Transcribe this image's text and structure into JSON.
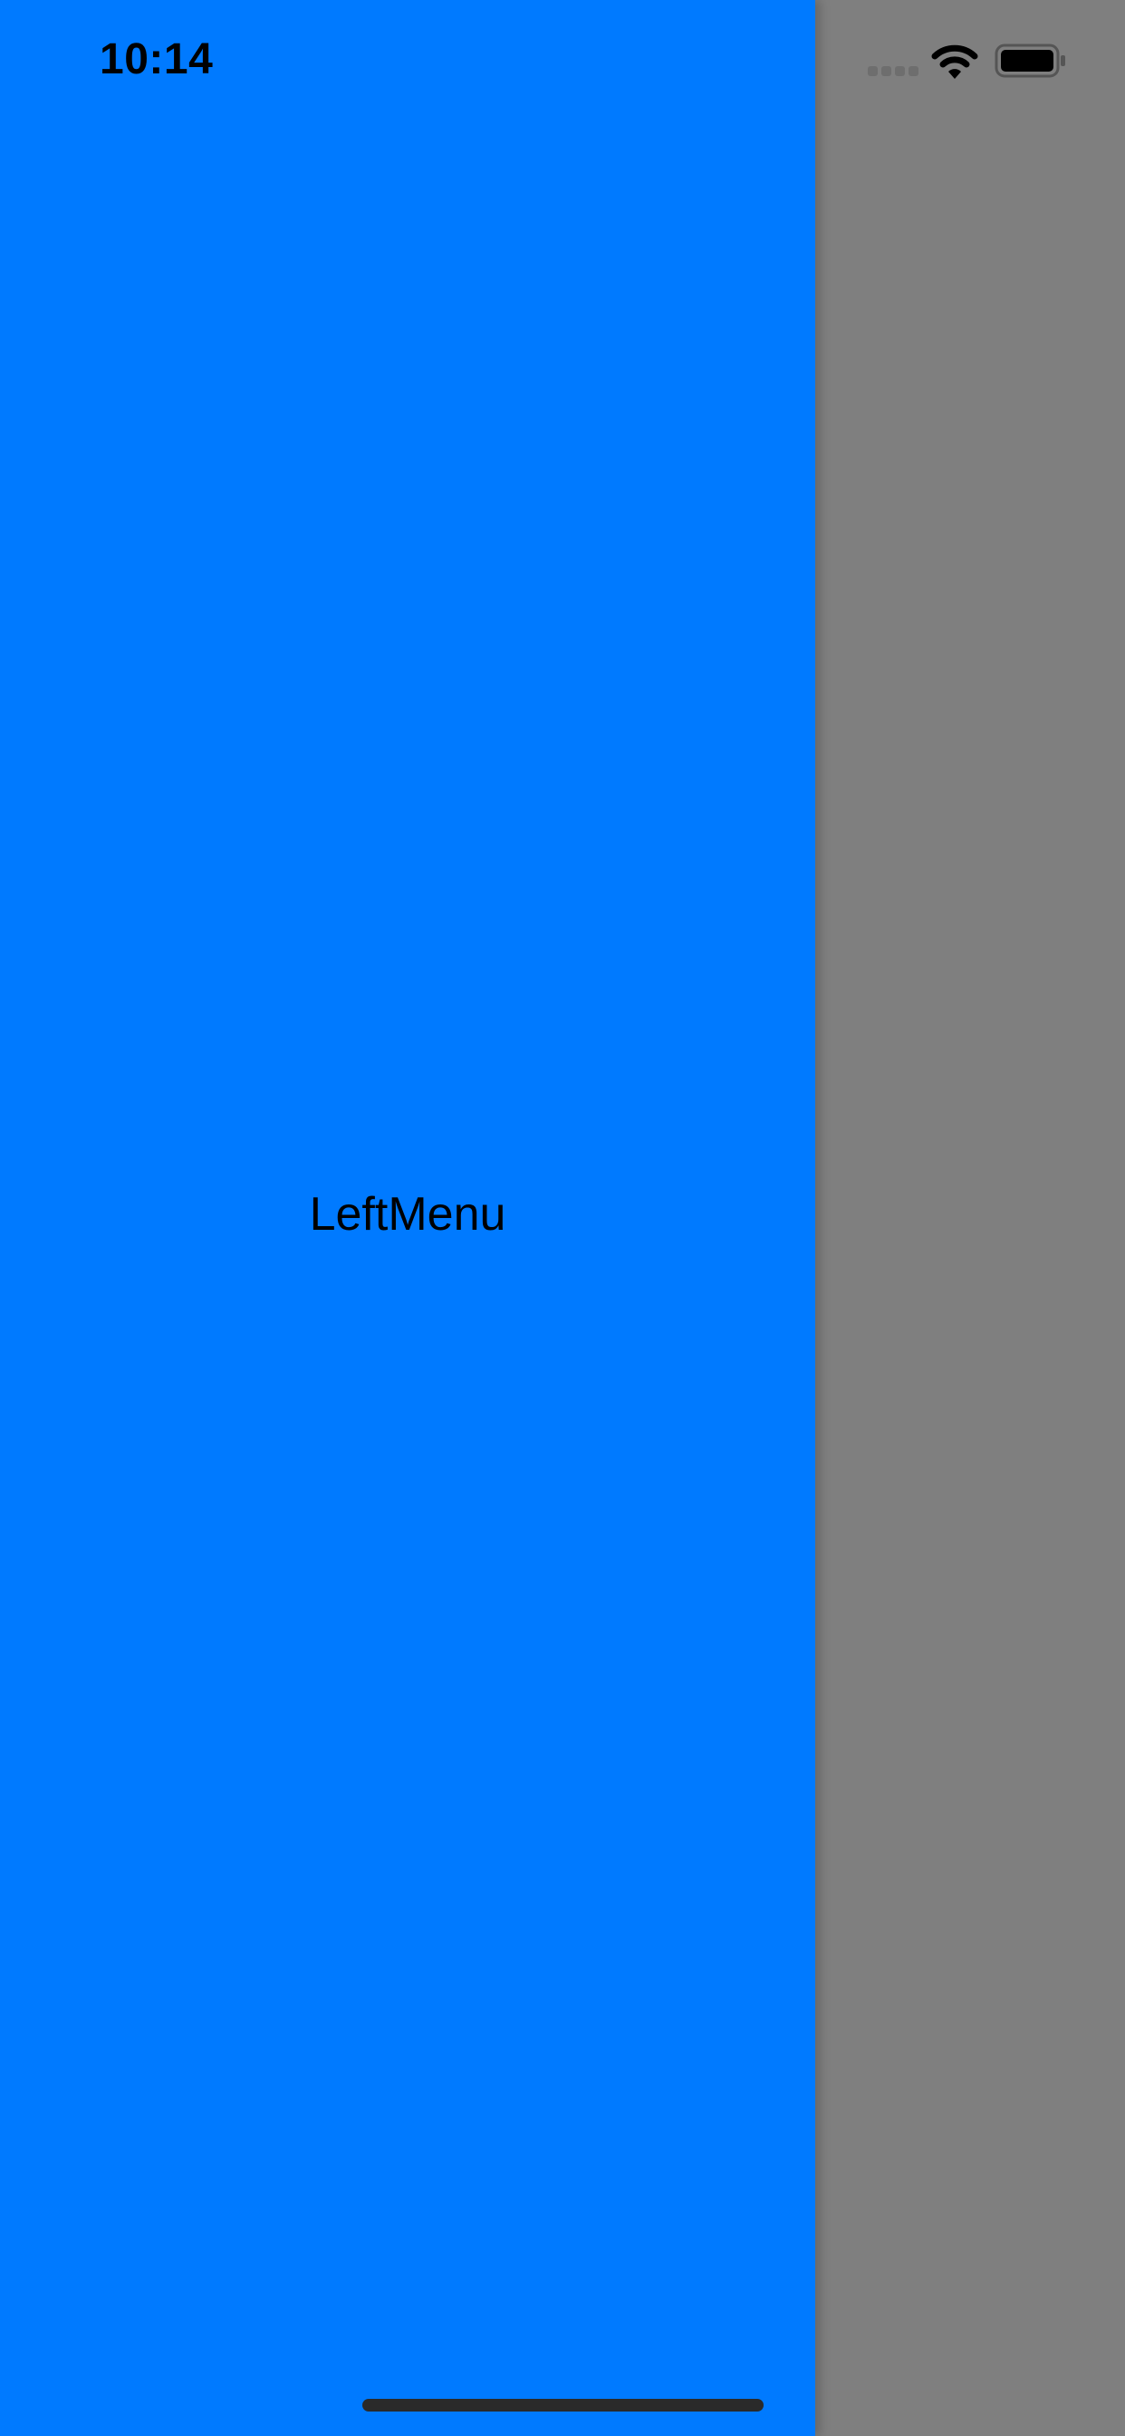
{
  "status_bar": {
    "time": "10:14",
    "signal_icon": "cellular-signal-icon",
    "wifi_icon": "wifi-icon",
    "battery_icon": "battery-icon"
  },
  "left_menu": {
    "label": "LeftMenu",
    "background_color": "#007aff"
  },
  "main_overlay": {
    "color": "#7f7f7f"
  },
  "home_indicator": {
    "icon": "home-indicator"
  }
}
